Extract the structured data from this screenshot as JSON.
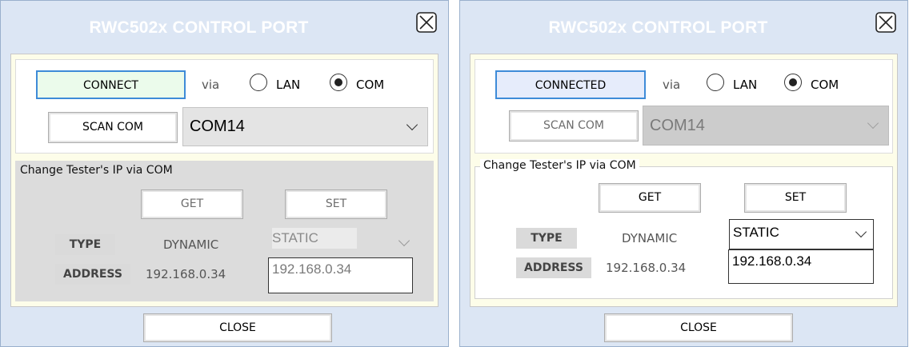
{
  "left": {
    "title": "RWC502x CONTROL PORT",
    "connect_button": "CONNECT",
    "via_label": "via",
    "lan_label": "LAN",
    "com_label": "COM",
    "scan_com_button": "SCAN COM",
    "com_port_value": "COM14",
    "group_title": "Change Tester's IP via COM",
    "get_button": "GET",
    "set_button": "SET",
    "type_label": "TYPE",
    "type_current": "DYNAMIC",
    "type_select_value": "STATIC",
    "address_label": "ADDRESS",
    "address_current": "192.168.0.34",
    "address_input_value": "192.168.0.34",
    "close_button": "CLOSE"
  },
  "right": {
    "title": "RWC502x CONTROL PORT",
    "connect_button": "CONNECTED",
    "via_label": "via",
    "lan_label": "LAN",
    "com_label": "COM",
    "scan_com_button": "SCAN COM",
    "com_port_value": "COM14",
    "group_title": "Change Tester's IP via COM",
    "get_button": "GET",
    "set_button": "SET",
    "type_label": "TYPE",
    "type_current": "DYNAMIC",
    "type_select_value": "STATIC",
    "address_label": "ADDRESS",
    "address_current": "192.168.0.34",
    "address_input_value": "192.168.0.34",
    "close_button": "CLOSE"
  },
  "colors": {
    "title_bar": "#dce6f4",
    "panel_inner": "#fdfde9",
    "connect_bg": "#ebfbeb",
    "connected_bg": "#e6ecfb",
    "focus_border": "#3e8bd8",
    "group_gray": "#dcdcdc"
  }
}
